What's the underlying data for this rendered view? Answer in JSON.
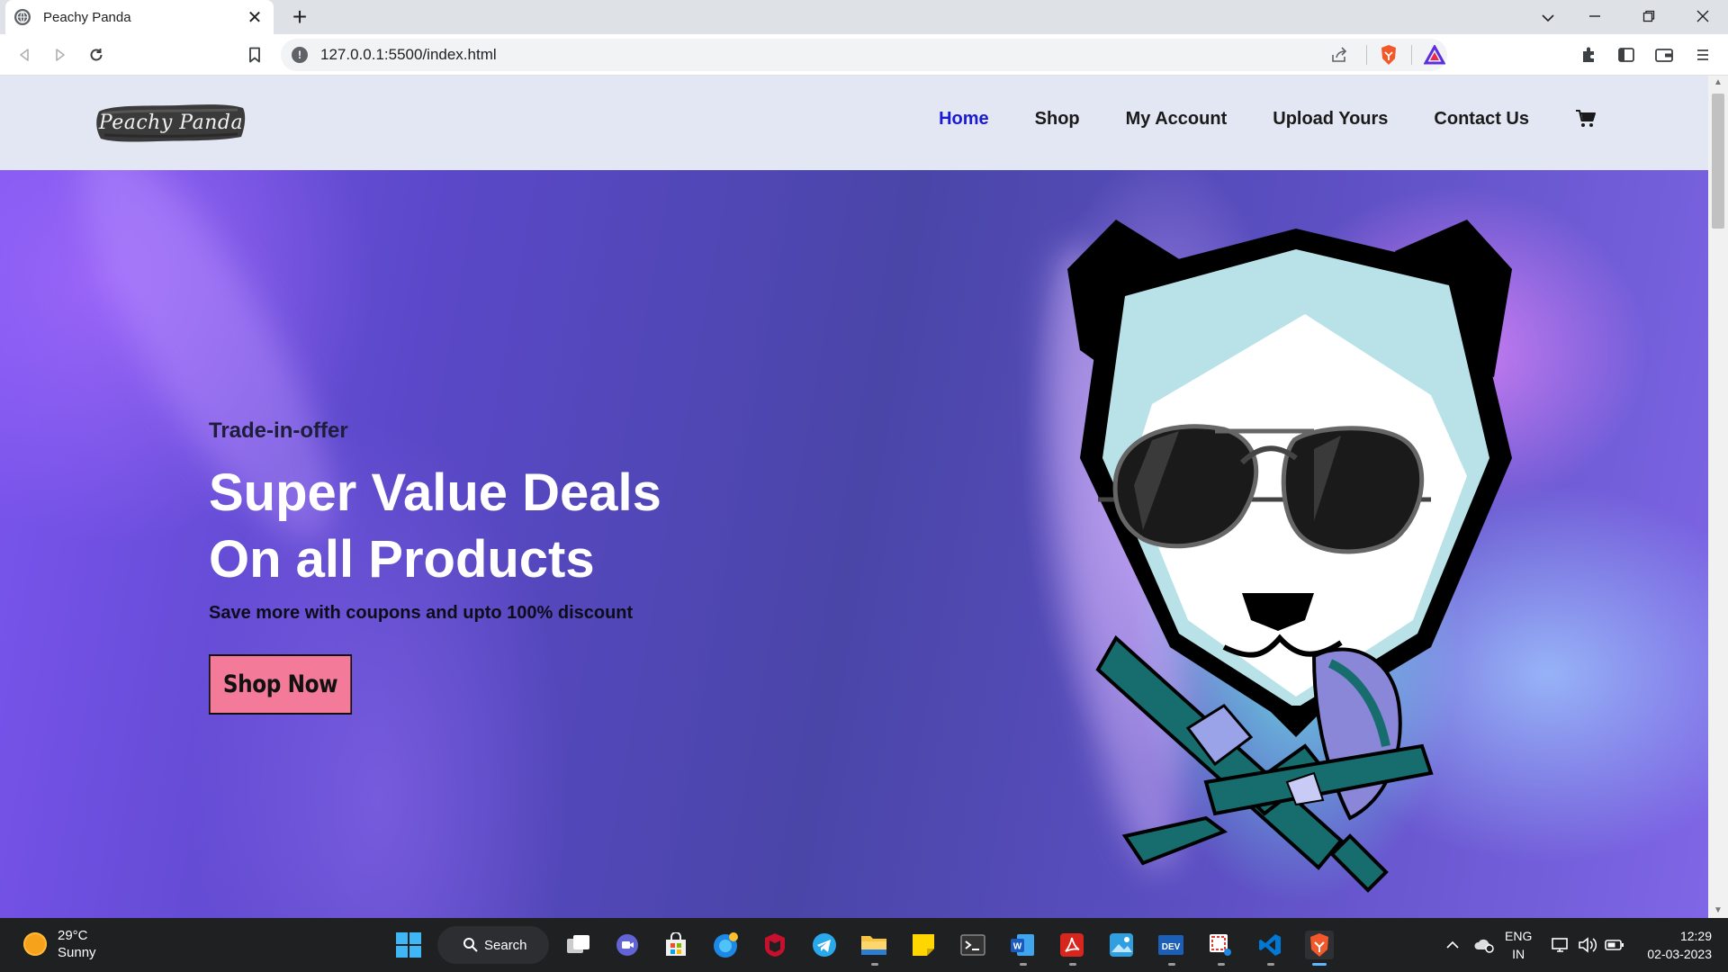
{
  "browser": {
    "tab_title": "Peachy Panda",
    "tab_close": "✕",
    "new_tab": "+",
    "url": "127.0.0.1:5500/index.html",
    "icons": [
      "globe-icon",
      "back-icon",
      "forward-icon",
      "reload-icon",
      "bookmark-icon",
      "info-icon",
      "share-icon",
      "brave-shield-icon",
      "brave-rewards-icon",
      "extensions-icon",
      "sidebar-icon",
      "wallet-icon",
      "menu-icon"
    ],
    "window_controls": {
      "dropdown": "⌄",
      "minimize": "—",
      "restore": "❐",
      "close": "✕"
    }
  },
  "site": {
    "logo_text": "Peachy Panda",
    "nav": [
      {
        "label": "Home",
        "active": true
      },
      {
        "label": "Shop"
      },
      {
        "label": "My Account"
      },
      {
        "label": "Upload Yours"
      },
      {
        "label": "Contact Us"
      }
    ],
    "cart_icon": "cart-icon",
    "accent_color": "#1a1ad0"
  },
  "hero": {
    "offer": "Trade-in-offer",
    "headline_line1": "Super Value Deals",
    "headline_line2": "On all Products",
    "subtitle": "Save more with coupons and upto 100% discount",
    "button_label": "Shop Now",
    "button_color": "#f37a98",
    "image": "panda-with-sunglasses-and-bowtie"
  },
  "taskbar": {
    "weather_temp": "29°C",
    "weather_desc": "Sunny",
    "search_label": "Search",
    "lang_line1": "ENG",
    "lang_line2": "IN",
    "time": "12:29",
    "date": "02-03-2023",
    "apps": [
      "windows-start",
      "search",
      "task-view",
      "teams-chat",
      "microsoft-store",
      "edge",
      "mcafee",
      "telegram",
      "file-explorer",
      "sticky-notes",
      "terminal",
      "word",
      "acrobat",
      "photos",
      "dev-home",
      "snipping-tool",
      "vscode",
      "brave"
    ]
  }
}
